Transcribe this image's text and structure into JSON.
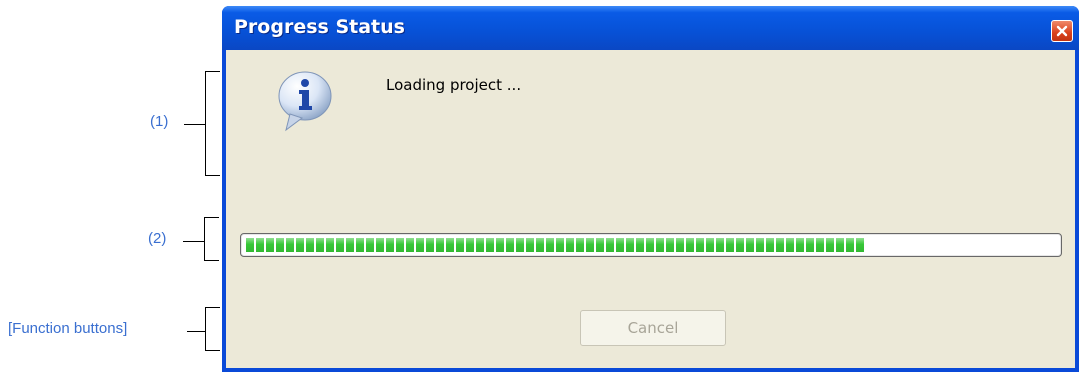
{
  "annotations": {
    "label_1": "(1)",
    "label_2": "(2)",
    "label_function": "[Function buttons]"
  },
  "window": {
    "title": "Progress Status",
    "close_icon": "close-icon",
    "titlebar_color": "#0a5be6"
  },
  "content": {
    "icon": "info-icon",
    "message": "Loading project ..."
  },
  "progress": {
    "fraction": 0.76,
    "color": "#37c837"
  },
  "buttons": {
    "cancel_label": "Cancel",
    "cancel_enabled": false
  }
}
